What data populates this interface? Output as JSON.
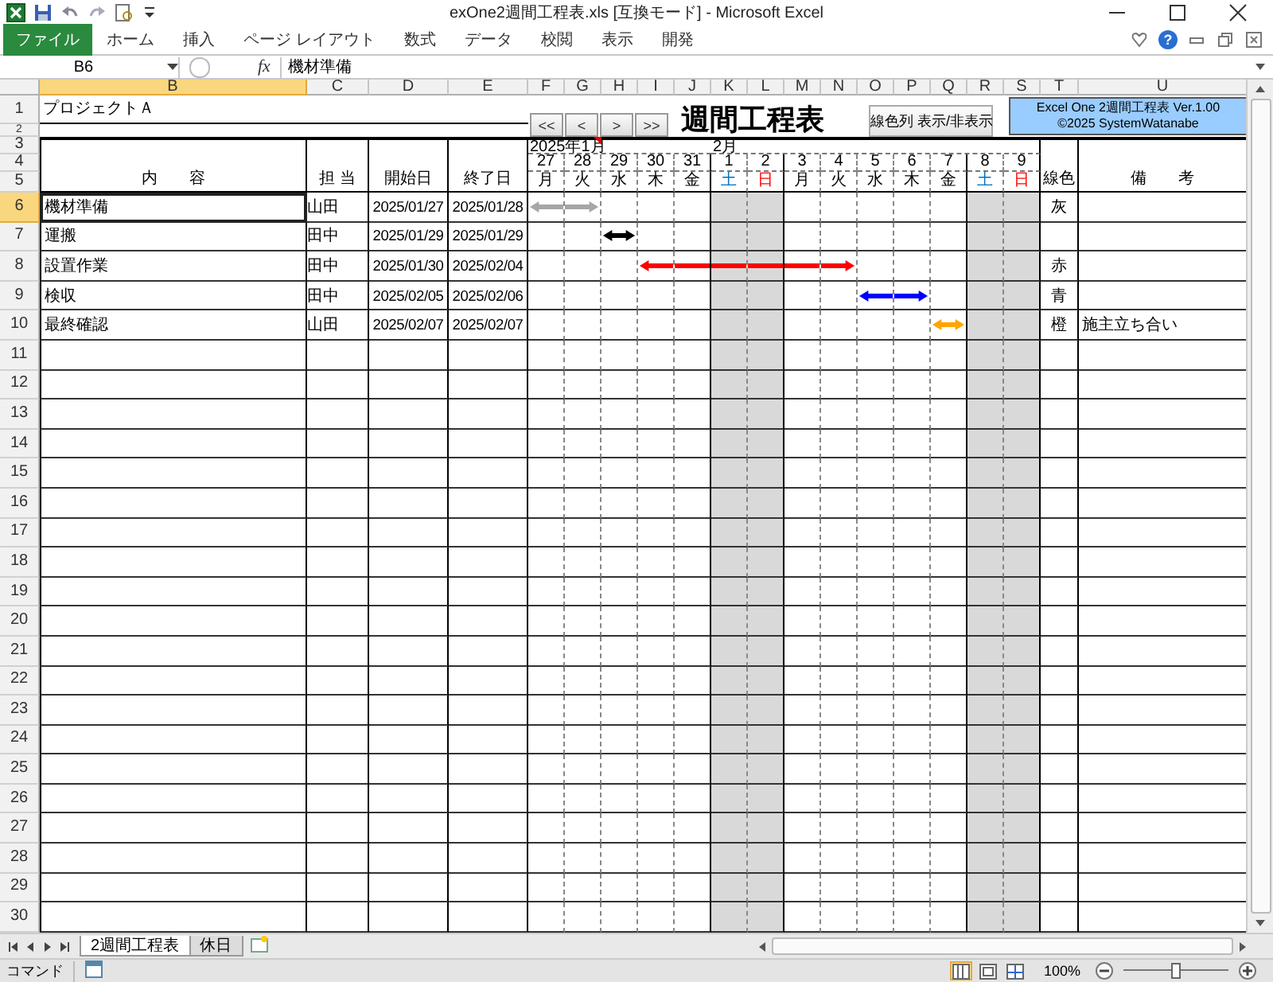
{
  "window": {
    "title": "exOne2週間工程表.xls [互換モード] - Microsoft Excel"
  },
  "ribbon_tabs": [
    {
      "label": "ファイル",
      "kind": "file"
    },
    {
      "label": "ホーム",
      "kind": "tab"
    },
    {
      "label": "挿入",
      "kind": "tab"
    },
    {
      "label": "ページ レイアウト",
      "kind": "tab"
    },
    {
      "label": "数式",
      "kind": "tab"
    },
    {
      "label": "データ",
      "kind": "tab"
    },
    {
      "label": "校閲",
      "kind": "tab"
    },
    {
      "label": "表示",
      "kind": "tab"
    },
    {
      "label": "開発",
      "kind": "tab"
    }
  ],
  "help_label": "?",
  "formula_bar": {
    "name_box": "B6",
    "function_label": "fx",
    "content": "機材準備"
  },
  "column_headers": [
    {
      "label": "B",
      "selected": true
    },
    {
      "label": "C",
      "selected": false
    },
    {
      "label": "D",
      "selected": false
    },
    {
      "label": "E",
      "selected": false
    },
    {
      "label": "F",
      "selected": false
    },
    {
      "label": "G",
      "selected": false
    },
    {
      "label": "H",
      "selected": false
    },
    {
      "label": "I",
      "selected": false
    },
    {
      "label": "J",
      "selected": false
    },
    {
      "label": "K",
      "selected": false
    },
    {
      "label": "L",
      "selected": false
    },
    {
      "label": "M",
      "selected": false
    },
    {
      "label": "N",
      "selected": false
    },
    {
      "label": "O",
      "selected": false
    },
    {
      "label": "P",
      "selected": false
    },
    {
      "label": "Q",
      "selected": false
    },
    {
      "label": "R",
      "selected": false
    },
    {
      "label": "S",
      "selected": false
    },
    {
      "label": "T",
      "selected": false
    },
    {
      "label": "U",
      "selected": false
    }
  ],
  "row_headers": [
    {
      "label": "1",
      "selected": false
    },
    {
      "label": "2",
      "selected": false
    },
    {
      "label": "3",
      "selected": false
    },
    {
      "label": "4",
      "selected": false
    },
    {
      "label": "5",
      "selected": false
    },
    {
      "label": "6",
      "selected": true
    },
    {
      "label": "7",
      "selected": false
    },
    {
      "label": "8",
      "selected": false
    },
    {
      "label": "9",
      "selected": false
    },
    {
      "label": "10",
      "selected": false
    },
    {
      "label": "11",
      "selected": false
    },
    {
      "label": "12",
      "selected": false
    },
    {
      "label": "13",
      "selected": false
    },
    {
      "label": "14",
      "selected": false
    },
    {
      "label": "15",
      "selected": false
    },
    {
      "label": "16",
      "selected": false
    },
    {
      "label": "17",
      "selected": false
    },
    {
      "label": "18",
      "selected": false
    },
    {
      "label": "19",
      "selected": false
    },
    {
      "label": "20",
      "selected": false
    },
    {
      "label": "21",
      "selected": false
    },
    {
      "label": "22",
      "selected": false
    },
    {
      "label": "23",
      "selected": false
    },
    {
      "label": "24",
      "selected": false
    },
    {
      "label": "25",
      "selected": false
    },
    {
      "label": "26",
      "selected": false
    },
    {
      "label": "27",
      "selected": false
    },
    {
      "label": "28",
      "selected": false
    },
    {
      "label": "29",
      "selected": false
    },
    {
      "label": "30",
      "selected": false
    }
  ],
  "sheet": {
    "project": "プロジェクトＡ",
    "nav_buttons": [
      "<<",
      "<",
      ">",
      ">>"
    ],
    "title": "週間工程表",
    "toggle_button": "線色列 表示/非表示",
    "info_box": [
      "Excel One 2週間工程表 Ver.1.00",
      "©2025 SystemWatanabe"
    ],
    "headers": {
      "content": "内　　容",
      "owner": "担 当",
      "start": "開始日",
      "end": "終了日",
      "line_color": "線色",
      "note": "備　　考"
    },
    "days": [
      {
        "day": "27",
        "weekday": "月",
        "kind": "weekday",
        "month": "2025年1月"
      },
      {
        "day": "28",
        "weekday": "火",
        "kind": "weekday",
        "comment": true
      },
      {
        "day": "29",
        "weekday": "水",
        "kind": "weekday"
      },
      {
        "day": "30",
        "weekday": "木",
        "kind": "weekday"
      },
      {
        "day": "31",
        "weekday": "金",
        "kind": "weekday"
      },
      {
        "day": "1",
        "weekday": "土",
        "kind": "saturday",
        "month": "2月"
      },
      {
        "day": "2",
        "weekday": "日",
        "kind": "sunday"
      },
      {
        "day": "3",
        "weekday": "月",
        "kind": "weekday"
      },
      {
        "day": "4",
        "weekday": "火",
        "kind": "weekday"
      },
      {
        "day": "5",
        "weekday": "水",
        "kind": "weekday"
      },
      {
        "day": "6",
        "weekday": "木",
        "kind": "weekday"
      },
      {
        "day": "7",
        "weekday": "金",
        "kind": "weekday"
      },
      {
        "day": "8",
        "weekday": "土",
        "kind": "saturday"
      },
      {
        "day": "9",
        "weekday": "日",
        "kind": "sunday"
      }
    ],
    "tasks": [
      {
        "content": "機材準備",
        "owner": "山田",
        "start": "2025/01/27",
        "end": "2025/01/28",
        "line_color": "灰",
        "color": "#a6a6a6",
        "selected": true,
        "bar": [
          true,
          true,
          false,
          false,
          false,
          false,
          false,
          false,
          false,
          false,
          false,
          false,
          false,
          false
        ]
      },
      {
        "content": "運搬",
        "owner": "田中",
        "start": "2025/01/29",
        "end": "2025/01/29",
        "color": "#000000",
        "selected": false,
        "bar": [
          false,
          false,
          true,
          false,
          false,
          false,
          false,
          false,
          false,
          false,
          false,
          false,
          false,
          false
        ]
      },
      {
        "content": "設置作業",
        "owner": "田中",
        "start": "2025/01/30",
        "end": "2025/02/04",
        "line_color": "赤",
        "color": "#ff0000",
        "selected": false,
        "bar": [
          false,
          false,
          false,
          true,
          true,
          true,
          true,
          true,
          true,
          false,
          false,
          false,
          false,
          false
        ]
      },
      {
        "content": "検収",
        "owner": "田中",
        "start": "2025/02/05",
        "end": "2025/02/06",
        "line_color": "青",
        "color": "#0000ff",
        "selected": false,
        "bar": [
          false,
          false,
          false,
          false,
          false,
          false,
          false,
          false,
          false,
          true,
          true,
          false,
          false,
          false
        ]
      },
      {
        "content": "最終確認",
        "owner": "山田",
        "start": "2025/02/07",
        "end": "2025/02/07",
        "line_color": "橙",
        "color": "#ffa500",
        "selected": false,
        "note": "施主立ち合い",
        "bar": [
          false,
          false,
          false,
          false,
          false,
          false,
          false,
          false,
          false,
          false,
          false,
          true,
          false,
          false
        ]
      }
    ]
  },
  "sheet_tabs": [
    {
      "label": "2週間工程表",
      "selected": true
    },
    {
      "label": "休日",
      "selected": false
    }
  ],
  "status_bar": {
    "mode": "コマンド",
    "view_buttons": [
      {
        "kind": "normal",
        "selected": true
      },
      {
        "kind": "page-layout",
        "selected": false
      },
      {
        "kind": "page-break",
        "selected": false
      }
    ],
    "zoom": "100%",
    "zoom_slider": {
      "level": 0.5
    }
  }
}
